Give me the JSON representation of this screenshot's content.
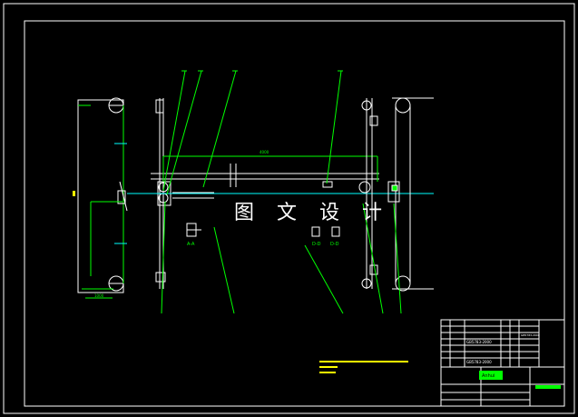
{
  "watermark": "图 文 设 计",
  "section_labels": {
    "a": "A-A",
    "d1": "D-D",
    "d2": "D-D"
  },
  "dimensions": {
    "span": "4000",
    "bottom": "1000"
  },
  "title_block": {
    "drawing_no_1": "GB5783-2000",
    "drawing_no_2": "GB5783-2000",
    "drawing_no_3": "GB5783-2000",
    "company": "Anhui"
  },
  "colors": {
    "background": "#000000",
    "frame": "#ffffff",
    "geometry": "#ffffff",
    "leader": "#00ff00",
    "hatch": "#ffff00",
    "watermark": "#ffffff",
    "note": "#ffff00",
    "stamp": "#00ff00"
  }
}
